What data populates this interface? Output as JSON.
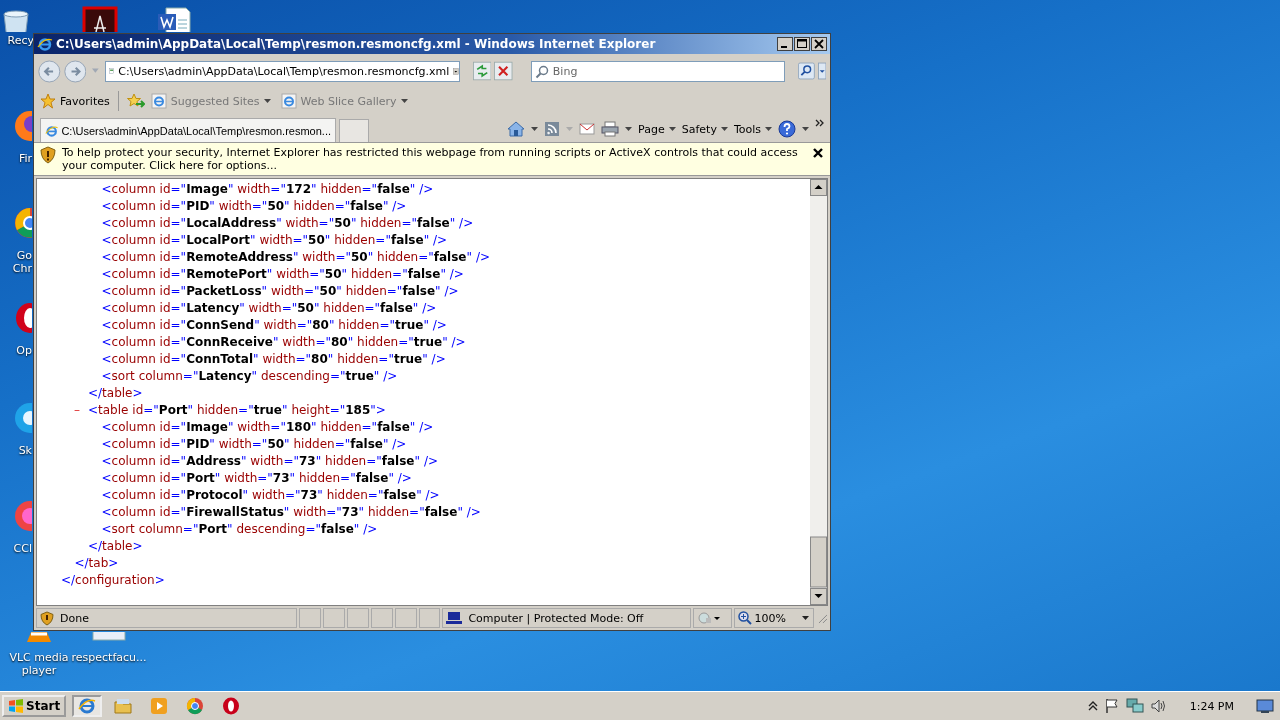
{
  "desktop_icons": [
    {
      "kind": "recycle",
      "label": "Recy"
    },
    {
      "kind": "pdf"
    },
    {
      "kind": "word"
    },
    {
      "kind": "firefox",
      "label": "Fir"
    },
    {
      "kind": "chrome",
      "label": "Go\nChr"
    },
    {
      "kind": "opera",
      "label": "Op"
    },
    {
      "kind": "skype",
      "label": "Sk"
    },
    {
      "kind": "ccleaner",
      "label": "CCl"
    },
    {
      "kind": "vlc",
      "label": "VLC media player"
    },
    {
      "kind": "file",
      "label": "respectfacu..."
    }
  ],
  "window": {
    "title": "C:\\Users\\admin\\AppData\\Local\\Temp\\resmon.resmoncfg.xml - Windows Internet Explorer",
    "address": "C:\\Users\\admin\\AppData\\Local\\Temp\\resmon.resmoncfg.xml",
    "search": {
      "placeholder": "Bing"
    },
    "favorites": {
      "label": "Favorites",
      "links": [
        {
          "label": "Suggested Sites"
        },
        {
          "label": "Web Slice Gallery"
        }
      ]
    },
    "tabs": [
      {
        "label": "C:\\Users\\admin\\AppData\\Local\\Temp\\resmon.resmon...",
        "selected": true
      }
    ],
    "commands": [
      {
        "label": "Page"
      },
      {
        "label": "Safety"
      },
      {
        "label": "Tools"
      }
    ],
    "info_bar": "To help protect your security, Internet Explorer has restricted this webpage from running scripts or ActiveX controls that could access your computer. Click here for options...",
    "xml": [
      {
        "children": [
          {
            "children": [
              {
                "children": [
                  {
                    "line": "<column id=\"Image\" width=\"172\" hidden=\"false\" />"
                  },
                  {
                    "line": "<column id=\"PID\" width=\"50\" hidden=\"false\" />"
                  },
                  {
                    "line": "<column id=\"LocalAddress\" width=\"50\" hidden=\"false\" />"
                  },
                  {
                    "line": "<column id=\"LocalPort\" width=\"50\" hidden=\"false\" />"
                  },
                  {
                    "line": "<column id=\"RemoteAddress\" width=\"50\" hidden=\"false\" />"
                  },
                  {
                    "line": "<column id=\"RemotePort\" width=\"50\" hidden=\"false\" />"
                  },
                  {
                    "line": "<column id=\"PacketLoss\" width=\"50\" hidden=\"false\" />"
                  },
                  {
                    "line": "<column id=\"Latency\" width=\"50\" hidden=\"false\" />"
                  },
                  {
                    "line": "<column id=\"ConnSend\" width=\"80\" hidden=\"true\" />"
                  },
                  {
                    "line": "<column id=\"ConnReceive\" width=\"80\" hidden=\"true\" />"
                  },
                  {
                    "line": "<column id=\"ConnTotal\" width=\"80\" hidden=\"true\" />"
                  },
                  {
                    "line": "<sort column=\"Latency\" descending=\"true\" />"
                  }
                ]
              },
              {
                "line": "</table>"
              },
              {
                "toggle": "–",
                "line": "<table id=\"Port\" hidden=\"true\" height=\"185\">",
                "children": [
                  {
                    "line": "<column id=\"Image\" width=\"180\" hidden=\"false\" />"
                  },
                  {
                    "line": "<column id=\"PID\" width=\"50\" hidden=\"false\" />"
                  },
                  {
                    "line": "<column id=\"Address\" width=\"73\" hidden=\"false\" />"
                  },
                  {
                    "line": "<column id=\"Port\" width=\"73\" hidden=\"false\" />"
                  },
                  {
                    "line": "<column id=\"Protocol\" width=\"73\" hidden=\"false\" />"
                  },
                  {
                    "line": "<column id=\"FirewallStatus\" width=\"73\" hidden=\"false\" />"
                  },
                  {
                    "line": "<sort column=\"Port\" descending=\"false\" />"
                  }
                ]
              },
              {
                "line": "</table>"
              }
            ]
          },
          {
            "line": "</tab>"
          }
        ]
      },
      {
        "line": "</configuration>"
      }
    ],
    "status_bar": {
      "text": "Done",
      "zone": "Computer | Protected Mode: Off",
      "zoom": "100%"
    }
  },
  "taskbar": {
    "start": "Start",
    "apps": [
      {
        "kind": "ie",
        "selected": true
      },
      {
        "kind": "explorer",
        "selected": false
      },
      {
        "kind": "media",
        "selected": false
      },
      {
        "kind": "chrome",
        "selected": false
      },
      {
        "kind": "opera",
        "selected": false
      }
    ],
    "clock": "1:24 PM"
  }
}
